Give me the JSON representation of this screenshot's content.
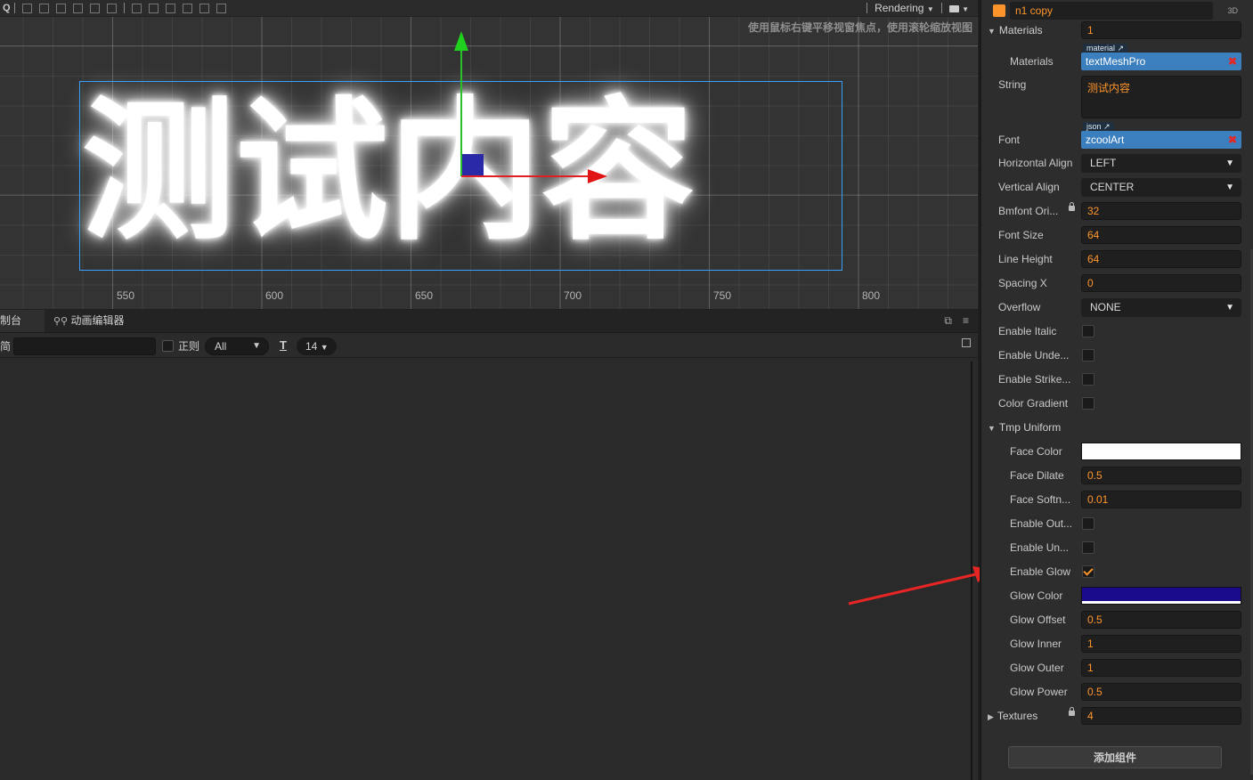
{
  "scene": {
    "toolbar": {
      "rendering_label": "Rendering"
    },
    "hint": "使用鼠标右键平移视窗焦点，使用滚轮缩放视图",
    "text": "测试内容",
    "ruler": [
      "550",
      "600",
      "650",
      "700",
      "750",
      "800"
    ]
  },
  "console": {
    "tabs": [
      {
        "label": "制台"
      },
      {
        "label": "动画编辑器"
      }
    ],
    "filter_left_label": "简",
    "regex_label": "正则",
    "level_select": "All",
    "font_size": "14"
  },
  "inspector": {
    "node_name": "n1 copy",
    "node_3d_label": "3D",
    "materials_section": "Materials",
    "materials_count": "1",
    "materials_item_label": "Materials",
    "materials_tag": "material",
    "materials_asset": "textMeshPro",
    "string_label": "String",
    "string_value": "测试内容",
    "font_label": "Font",
    "font_tag": "json",
    "font_asset": "zcoolArt",
    "h_align_label": "Horizontal Align",
    "h_align_value": "LEFT",
    "v_align_label": "Vertical Align",
    "v_align_value": "CENTER",
    "bmfont_label": "Bmfont Ori...",
    "bmfont_value": "32",
    "font_size_label": "Font Size",
    "font_size_value": "64",
    "line_height_label": "Line Height",
    "line_height_value": "64",
    "spacing_x_label": "Spacing X",
    "spacing_x_value": "0",
    "overflow_label": "Overflow",
    "overflow_value": "NONE",
    "enable_italic_label": "Enable Italic",
    "enable_underline_label": "Enable Unde...",
    "enable_strike_label": "Enable Strike...",
    "color_gradient_label": "Color Gradient",
    "tmp_uniform_section": "Tmp Uniform",
    "face_color_label": "Face Color",
    "face_color": "#ffffff",
    "face_dilate_label": "Face Dilate",
    "face_dilate_value": "0.5",
    "face_softness_label": "Face Softn...",
    "face_softness_value": "0.01",
    "enable_outline_label": "Enable Out...",
    "enable_underlay_label": "Enable Un...",
    "enable_glow_label": "Enable Glow",
    "glow_color_label": "Glow Color",
    "glow_color": "#1a0a8c",
    "glow_offset_label": "Glow Offset",
    "glow_offset_value": "0.5",
    "glow_inner_label": "Glow Inner",
    "glow_inner_value": "1",
    "glow_outer_label": "Glow Outer",
    "glow_outer_value": "1",
    "glow_power_label": "Glow Power",
    "glow_power_value": "0.5",
    "textures_section": "Textures",
    "textures_value": "4",
    "add_component_label": "添加组件"
  },
  "colors": {
    "accent": "#fd942b",
    "asset_blue": "#3b7fbf",
    "annotation_red": "#e82525"
  }
}
